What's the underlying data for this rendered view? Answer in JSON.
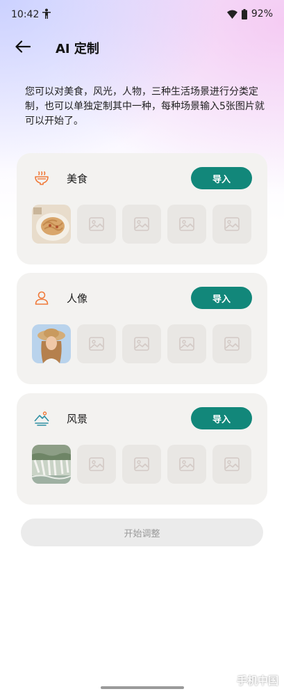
{
  "status_bar": {
    "time": "10:42",
    "battery": "92%"
  },
  "header": {
    "title": "AI 定制"
  },
  "description": "您可以对美食，风光，人物，三种生活场景进行分类定制，也可以单独定制其中一种，每种场景输入5张图片就可以开始了。",
  "categories": [
    {
      "label": "美食",
      "icon": "bowl-icon",
      "import_label": "导入"
    },
    {
      "label": "人像",
      "icon": "person-icon",
      "import_label": "导入"
    },
    {
      "label": "风景",
      "icon": "landscape-icon",
      "import_label": "导入"
    }
  ],
  "start_button": {
    "label": "开始调整"
  },
  "watermark": "手机中国",
  "colors": {
    "accent": "#12877a",
    "icon_orange": "#f07a3a",
    "icon_teal": "#2d8fa3",
    "card_bg": "#f3f2f0",
    "slot_bg": "#e9e7e4"
  }
}
